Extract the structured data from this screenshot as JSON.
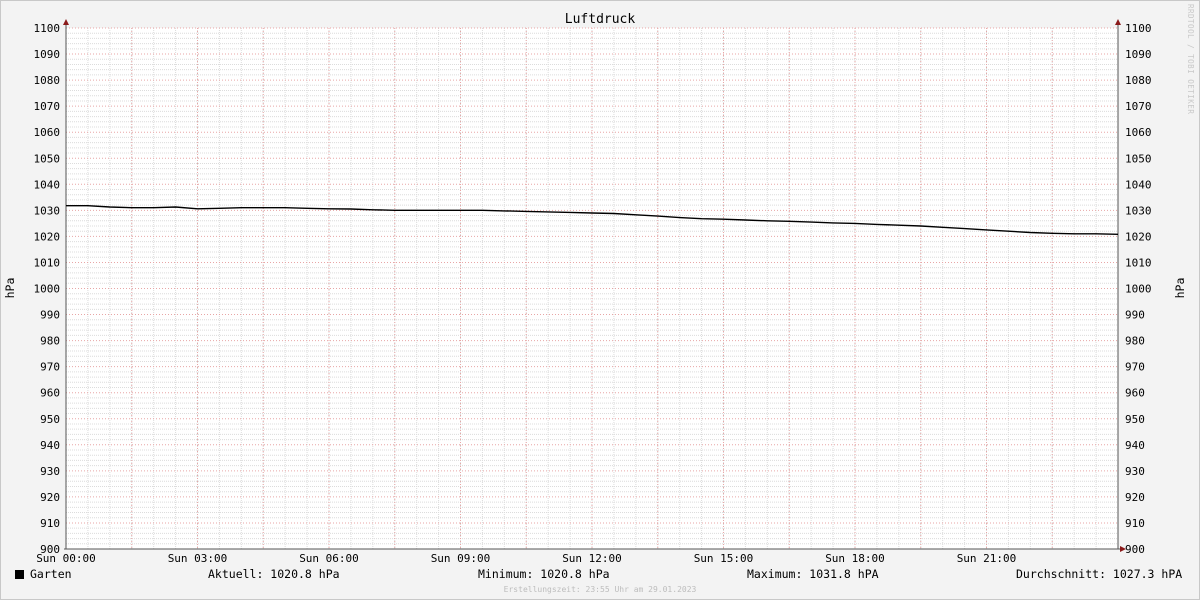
{
  "chart_data": {
    "type": "line",
    "title": "Luftdruck",
    "ylabel_left": "hPa",
    "ylabel_right": "hPa",
    "ylim": [
      900,
      1100
    ],
    "xlim": [
      "Sun 00:00",
      "Sun 24:00"
    ],
    "y_ticks": [
      900,
      910,
      920,
      930,
      940,
      950,
      960,
      970,
      980,
      990,
      1000,
      1010,
      1020,
      1030,
      1040,
      1050,
      1060,
      1070,
      1080,
      1090,
      1100
    ],
    "x_tick_labels": [
      "Sun 00:00",
      "Sun 03:00",
      "Sun 06:00",
      "Sun 09:00",
      "Sun 12:00",
      "Sun 15:00",
      "Sun 18:00",
      "Sun 21:00"
    ],
    "grid": true,
    "legend_position": "bottom-left",
    "series": [
      {
        "name": "Garten",
        "color": "#000000",
        "x_hours": [
          0,
          0.5,
          1.0,
          1.5,
          2.0,
          2.5,
          3.0,
          3.5,
          4.0,
          4.5,
          5.0,
          5.5,
          6.0,
          6.5,
          7.0,
          7.5,
          8.0,
          8.5,
          9.0,
          9.5,
          10.0,
          10.5,
          11.0,
          11.5,
          12.0,
          12.5,
          13.0,
          13.5,
          14.0,
          14.5,
          15.0,
          15.5,
          16.0,
          16.5,
          17.0,
          17.5,
          18.0,
          18.5,
          19.0,
          19.5,
          20.0,
          20.5,
          21.0,
          21.5,
          22.0,
          22.5,
          23.0,
          23.5,
          24.0
        ],
        "values": [
          1031.8,
          1031.8,
          1031.3,
          1031.0,
          1031.0,
          1031.3,
          1030.6,
          1030.8,
          1031.0,
          1031.0,
          1031.0,
          1030.8,
          1030.6,
          1030.5,
          1030.2,
          1030.0,
          1030.0,
          1030.0,
          1030.0,
          1030.0,
          1029.8,
          1029.6,
          1029.4,
          1029.2,
          1029.0,
          1028.8,
          1028.3,
          1027.8,
          1027.2,
          1026.8,
          1026.6,
          1026.3,
          1026.0,
          1025.8,
          1025.5,
          1025.2,
          1025.0,
          1024.6,
          1024.3,
          1024.0,
          1023.5,
          1023.0,
          1022.5,
          1022.0,
          1021.5,
          1021.2,
          1021.0,
          1021.0,
          1020.8
        ]
      }
    ]
  },
  "stats": {
    "legend_label": "Garten",
    "current": "Aktuell: 1020.8 hPa",
    "minimum": "Minimum: 1020.8 hPa",
    "maximum": "Maximum: 1031.8 hPA",
    "average": "Durchschnitt: 1027.3 hPA"
  },
  "credit": "RRDTOOL / TOBI OETIKER",
  "footer": "Erstellungszeit: 23:55 Uhr am 29.01.2023"
}
